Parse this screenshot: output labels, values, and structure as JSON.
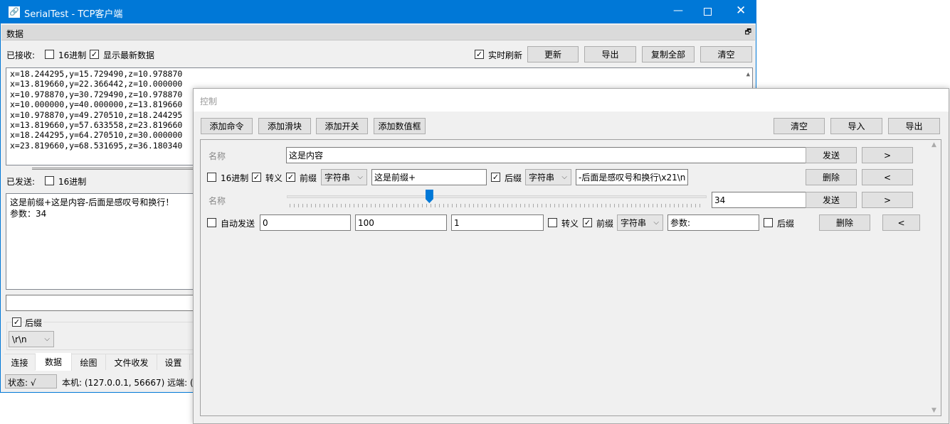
{
  "main": {
    "title": "SerialTest - TCP客户端",
    "section": "数据",
    "received_label": "已接收:",
    "hex_label": "16进制",
    "show_latest_label": "显示最新数据",
    "realtime_label": "实时刷新",
    "buttons": [
      "更新",
      "导出",
      "复制全部",
      "清空"
    ],
    "received_lines": [
      "x=18.244295,y=15.729490,z=10.978870",
      "x=13.819660,y=22.366442,z=10.000000",
      "x=10.978870,y=30.729490,z=10.978870",
      "x=10.000000,y=40.000000,z=13.819660",
      "x=10.978870,y=49.270510,z=18.244295",
      "x=13.819660,y=57.633558,z=23.819660",
      "x=18.244295,y=64.270510,z=30.000000",
      "x=23.819660,y=68.531695,z=36.180340"
    ],
    "sent_label": "已发送:",
    "sent_hex_label": "16进制",
    "sent_lines": [
      "这是前缀+这是内容-后面是感叹号和换行！",
      "参数：34"
    ],
    "send_input": "",
    "suffix_label": "后缀",
    "suffix_value": "\\r\\n",
    "tabs": [
      "连接",
      "数据",
      "绘图",
      "文件收发",
      "设置"
    ],
    "active_tab": "数据",
    "status": "状态: √",
    "status_info": "本机: (127.0.0.1, 56667) 远端: (12"
  },
  "control": {
    "title": "控制",
    "add_buttons": [
      "添加命令",
      "添加滑块",
      "添加开关",
      "添加数值框"
    ],
    "right_buttons": [
      "清空",
      "导入",
      "导出"
    ],
    "cmd": {
      "name_label": "名称",
      "content": "这是内容",
      "send": "发送",
      "move_right": ">",
      "hex": "16进制",
      "escape": "转义",
      "prefix": "前缀",
      "prefix_type": "字符串",
      "prefix_value": "这是前缀+",
      "suffix": "后缀",
      "suffix_type": "字符串",
      "suffix_value": "-后面是感叹号和换行\\x21\\n",
      "delete": "删除",
      "move_left": "<"
    },
    "slider": {
      "name_label": "名称",
      "value": "34",
      "min": "0",
      "max": "100",
      "step": "1",
      "level": 34,
      "send": "发送",
      "move_right": ">",
      "auto_send": "自动发送",
      "escape": "转义",
      "prefix": "前缀",
      "prefix_type": "字符串",
      "prefix_value": "参数:",
      "suffix": "后缀",
      "delete": "删除",
      "move_left": "<"
    }
  },
  "colors": {
    "titlebar": "#0078d7",
    "accent": "#0078d7"
  }
}
